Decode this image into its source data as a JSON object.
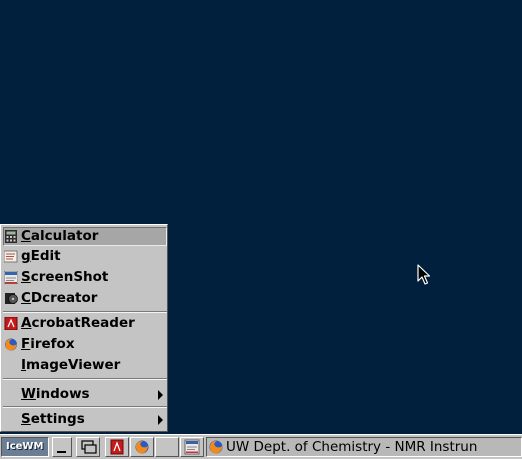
{
  "menu": {
    "items": [
      {
        "label": "Calculator",
        "icon": "calculator-icon"
      },
      {
        "label": "gEdit",
        "icon": "gedit-icon"
      },
      {
        "label": "ScreenShot",
        "icon": "screenshot-icon"
      },
      {
        "label": "CDcreator",
        "icon": "cd-creator-icon"
      },
      {
        "label": "AcrobatReader",
        "icon": "acrobat-icon"
      },
      {
        "label": "Firefox",
        "icon": "firefox-icon"
      },
      {
        "label": "ImageViewer",
        "icon": ""
      },
      {
        "label": "Windows",
        "submenu": true
      },
      {
        "label": "Settings",
        "submenu": true
      }
    ],
    "selected": "Calculator"
  },
  "taskbar": {
    "start_label": "IceWM",
    "task_title": "UW Dept. of Chemistry - NMR Instrun"
  },
  "colors": {
    "desktop": "#00203e",
    "menu_bg": "#c4c4c4",
    "selected_bg": "#a6a6a6"
  }
}
